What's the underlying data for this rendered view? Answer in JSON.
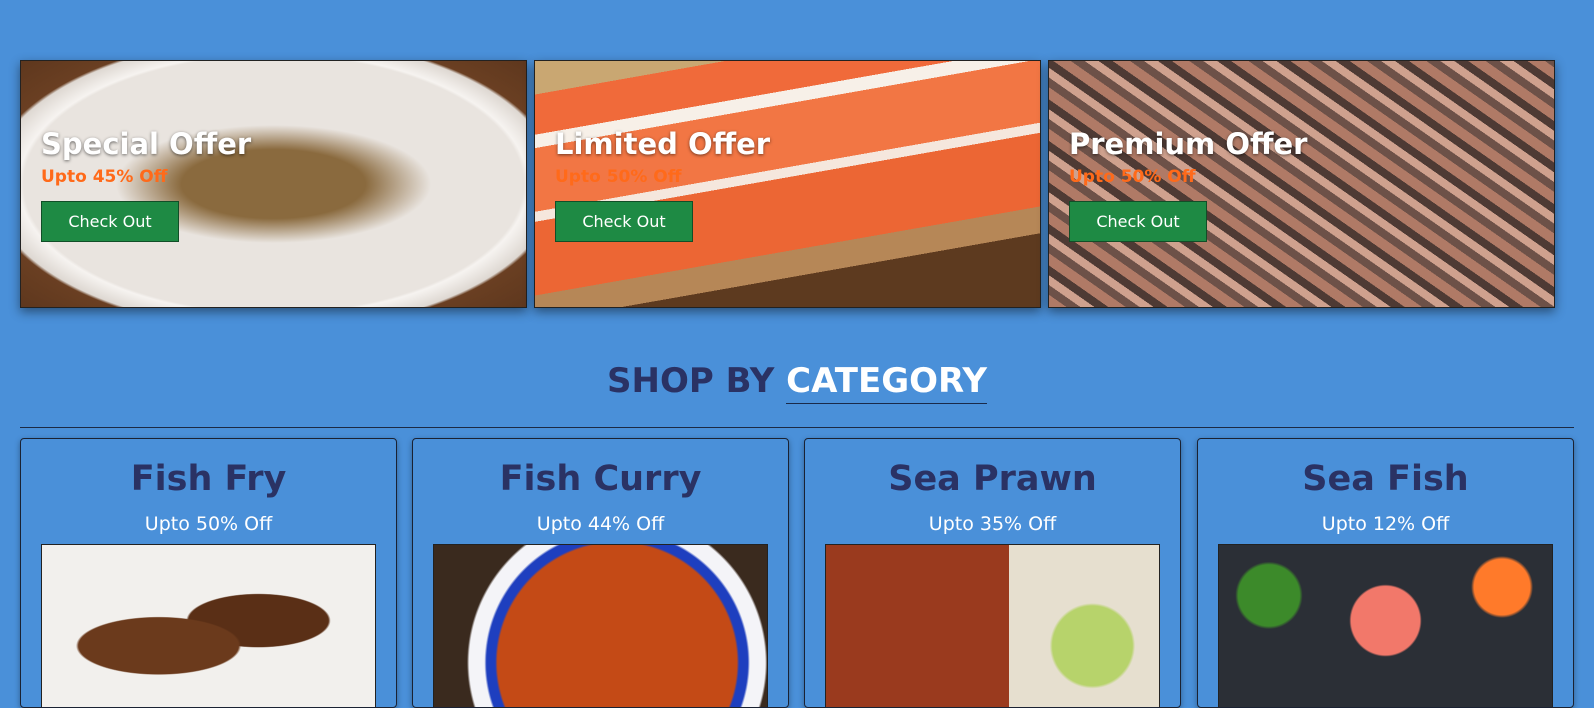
{
  "offers": [
    {
      "title": "Special Offer",
      "discount": "Upto 45% Off",
      "button": "Check Out"
    },
    {
      "title": "Limited Offer",
      "discount": "Upto 50% Off",
      "button": "Check Out"
    },
    {
      "title": "Premium Offer",
      "discount": "Upto 50% Off",
      "button": "Check Out"
    }
  ],
  "category_section": {
    "title_part1": "SHOP BY",
    "title_part2": "CATEGORY"
  },
  "categories": [
    {
      "name": "Fish Fry",
      "discount": "Upto 50% Off"
    },
    {
      "name": "Fish Curry",
      "discount": "Upto 44% Off"
    },
    {
      "name": "Sea Prawn",
      "discount": "Upto 35% Off"
    },
    {
      "name": "Sea Fish",
      "discount": "Upto 12% Off"
    }
  ],
  "colors": {
    "page_background": "#4a90d9",
    "button": "#1e8a44",
    "offer_discount": "#ff6a1a",
    "heading_dark": "#2a3264"
  }
}
